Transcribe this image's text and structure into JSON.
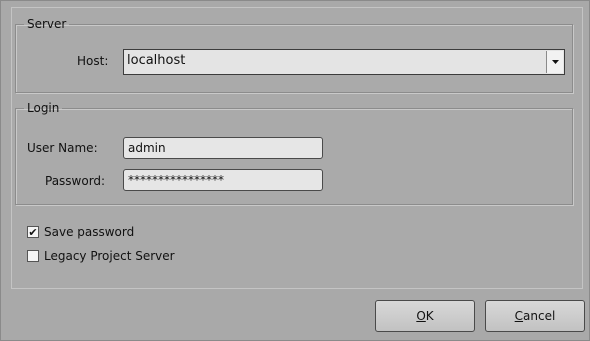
{
  "server": {
    "legend": "Server",
    "host_label": "Host:",
    "host_value": "localhost"
  },
  "login": {
    "legend": "Login",
    "username_label": "User Name:",
    "username_value": "admin",
    "password_label": "Password:",
    "password_value": "****************"
  },
  "options": {
    "save_password": {
      "label": "Save password",
      "checked": true,
      "mark": "✔"
    },
    "legacy_server": {
      "label": "Legacy Project Server",
      "checked": false
    }
  },
  "buttons": {
    "ok": {
      "mnemonic": "O",
      "rest": "K"
    },
    "cancel": {
      "mnemonic": "C",
      "rest": "ancel"
    }
  },
  "colors": {
    "background": "#a9a9a9",
    "field": "#e6e6e6",
    "border": "#4a4a4a"
  }
}
